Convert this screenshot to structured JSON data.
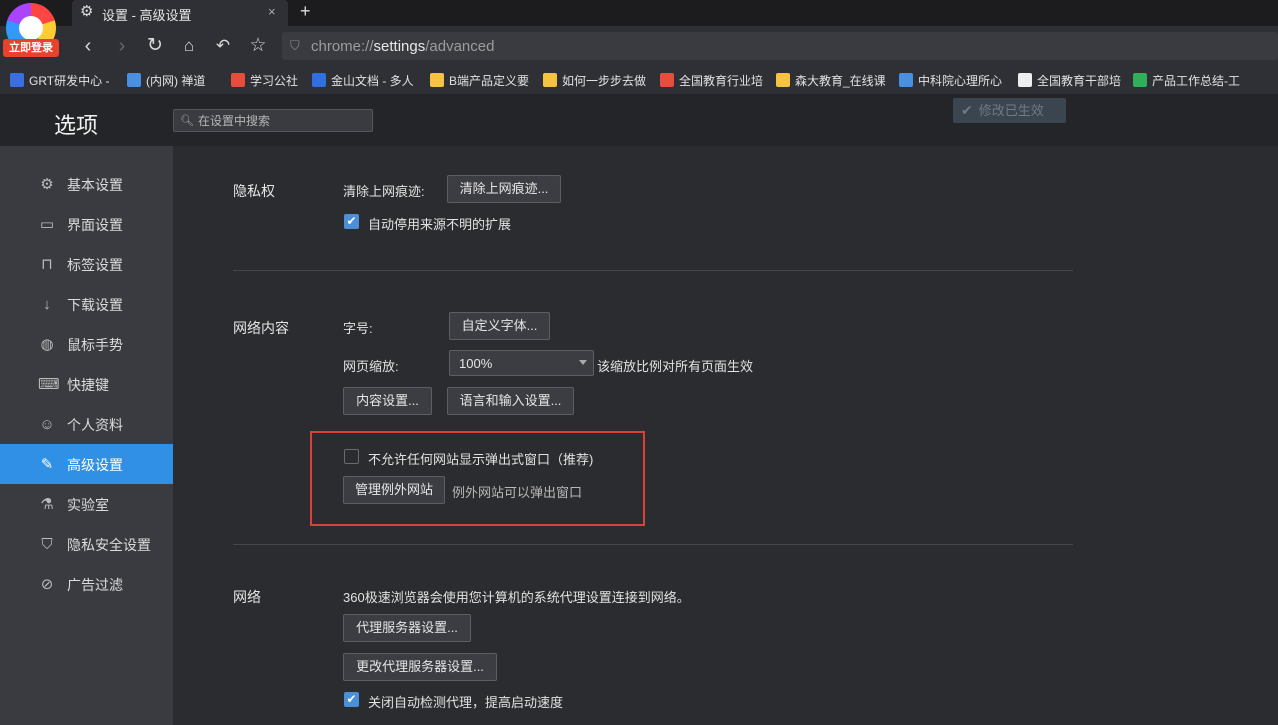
{
  "browser": {
    "login_badge": "立即登录",
    "tab_title": "设置 - 高级设置",
    "tab_close": "×",
    "new_tab": "+",
    "address_prefix": "chrome://",
    "address_bold": "settings",
    "address_suffix": "/advanced"
  },
  "bookmarks": [
    {
      "label": "GRT研发中心 -",
      "icon_color": "#3b6fe0"
    },
    {
      "label": "(内网) 禅道",
      "icon_color": "#4a90e2"
    },
    {
      "label": "学习公社",
      "icon_color": "#e74c3c"
    },
    {
      "label": "金山文档 - 多人",
      "icon_color": "#2f6fe0"
    },
    {
      "label": "B端产品定义要",
      "icon_color": "#f5c242"
    },
    {
      "label": "如何一步步去做",
      "icon_color": "#f5c242"
    },
    {
      "label": "全国教育行业培",
      "icon_color": "#e74c3c"
    },
    {
      "label": "森大教育_在线课",
      "icon_color": "#f5c242"
    },
    {
      "label": "中科院心理所心",
      "icon_color": "#4a90e2"
    },
    {
      "label": "全国教育干部培",
      "icon_color": "#eeeeee"
    },
    {
      "label": "产品工作总结-工",
      "icon_color": "#2fae5c"
    }
  ],
  "header": {
    "title": "选项",
    "search_placeholder": "在设置中搜索",
    "applied_label": "修改已生效"
  },
  "sidebar": {
    "items": [
      {
        "label": "基本设置",
        "icon": "circle-gear-icon"
      },
      {
        "label": "界面设置",
        "icon": "window-icon"
      },
      {
        "label": "标签设置",
        "icon": "tab-icon"
      },
      {
        "label": "下载设置",
        "icon": "download-icon"
      },
      {
        "label": "鼠标手势",
        "icon": "mouse-icon"
      },
      {
        "label": "快捷键",
        "icon": "keyboard-icon"
      },
      {
        "label": "个人资料",
        "icon": "person-icon"
      },
      {
        "label": "高级设置",
        "icon": "wrench-icon"
      },
      {
        "label": "实验室",
        "icon": "flask-icon"
      },
      {
        "label": "隐私安全设置",
        "icon": "shield-icon"
      },
      {
        "label": "广告过滤",
        "icon": "block-icon"
      }
    ],
    "active_index": 7
  },
  "privacy": {
    "title": "隐私权",
    "clear_label": "清除上网痕迹:",
    "clear_button": "清除上网痕迹...",
    "auto_disable_label": "自动停用来源不明的扩展",
    "auto_disable_checked": true
  },
  "web_content": {
    "title": "网络内容",
    "font_label": "字号:",
    "font_button": "自定义字体...",
    "zoom_label": "网页缩放:",
    "zoom_value": "100%",
    "zoom_hint": "该缩放比例对所有页面生效",
    "content_settings_button": "内容设置...",
    "language_button": "语言和输入设置...",
    "popup_block_label": "不允许任何网站显示弹出式窗口（推荐)",
    "popup_block_checked": false,
    "manage_exceptions_button": "管理例外网站",
    "exceptions_hint": "例外网站可以弹出窗口"
  },
  "network": {
    "title": "网络",
    "description": "360极速浏览器会使用您计算机的系统代理设置连接到网络。",
    "proxy_button": "代理服务器设置...",
    "change_proxy_button": "更改代理服务器设置...",
    "auto_detect_label": "关闭自动检测代理，提高启动速度",
    "auto_detect_checked": true
  }
}
